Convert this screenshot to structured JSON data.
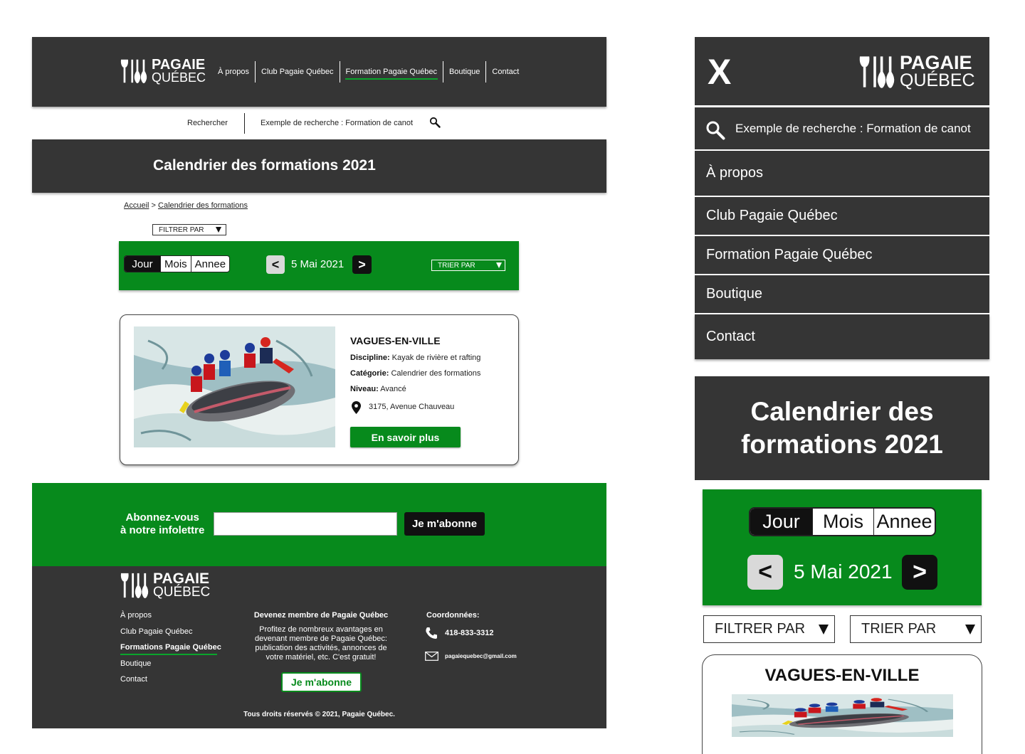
{
  "brand": {
    "line1": "PAGAIE",
    "line2": "QUÉBEC"
  },
  "nav": [
    {
      "label": "À propos",
      "active": false
    },
    {
      "label": "Club Pagaie Québec",
      "active": false
    },
    {
      "label": "Formation Pagaie Québec",
      "active": true
    },
    {
      "label": "Boutique",
      "active": false
    },
    {
      "label": "Contact",
      "active": false
    }
  ],
  "search": {
    "label": "Rechercher",
    "placeholder": "Exemple de recherche : Formation de canot"
  },
  "page_title": "Calendrier des formations 2021",
  "mobile_title": {
    "line1": "Calendrier des",
    "line2": "formations 2021"
  },
  "breadcrumb": {
    "home": "Accueil",
    "sep": " > ",
    "current": "Calendrier des formations"
  },
  "filter_label": "FILTRER PAR",
  "sort_label": "TRIER PAR",
  "view_tabs": [
    {
      "label": "Jour",
      "active": true
    },
    {
      "label": "Mois",
      "active": false
    },
    {
      "label": "Annee",
      "active": false
    }
  ],
  "date_nav": {
    "prev": "<",
    "date": "5 Mai 2021",
    "next": ">"
  },
  "event": {
    "title": "VAGUES-EN-VILLE",
    "discipline_label": "Discipline:",
    "discipline": " Kayak de rivière et rafting",
    "category_label": "Catégorie:",
    "category": " Calendrier des formations",
    "level_label": "Niveau:",
    "level": " Avancé",
    "address": "3175, Avenue Chauveau",
    "button": "En savoir plus"
  },
  "newsletter": {
    "line1": "Abonnez-vous",
    "line2": "à notre infolettre",
    "button": "Je m'abonne"
  },
  "footer": {
    "links": [
      {
        "label": "À propos",
        "active": false
      },
      {
        "label": "Club Pagaie Québec",
        "active": false
      },
      {
        "label": "Formations Pagaie Québec",
        "active": true
      },
      {
        "label": "Boutique",
        "active": false
      },
      {
        "label": "Contact",
        "active": false
      }
    ],
    "member_title": "Devenez membre de Pagaie Québec",
    "member_text": "Profitez de nombreux avantages en devenant membre de Pagaie Québec: publication des activités, annonces de votre matériel, etc. C'est gratuit!",
    "member_button": "Je m'abonne",
    "contact_title": "Coordonnées:",
    "phone": "418-833-3312",
    "email": "pagaiequebec@gmail.com",
    "copyright": "Tous droits réservés © 2021, Pagaie Québec."
  },
  "mobile_menu": {
    "close": "X",
    "search_placeholder": "Exemple de recherche : Formation de canot",
    "items": [
      "À propos",
      "Club Pagaie Québec",
      "Formation Pagaie Québec",
      "Boutique",
      "Contact"
    ]
  },
  "colors": {
    "dark": "#353535",
    "green": "#078A1C",
    "accent_underline": "#0aa52c"
  },
  "icons": [
    "paddle-logo-icon",
    "search-icon",
    "map-pin-icon",
    "phone-icon",
    "mail-icon",
    "dropdown-arrow-icon"
  ]
}
